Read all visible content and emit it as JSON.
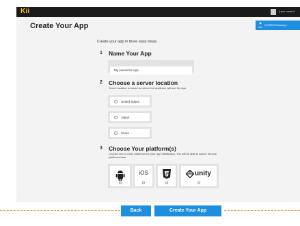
{
  "header": {
    "logo": "Kii",
    "user_name": "(user name h"
  },
  "page": {
    "title": "Create Your App",
    "download_label": "IOSSDKTutorial.pr",
    "intro": "Create your app in three easy steps."
  },
  "steps": [
    {
      "num": "1",
      "title": "Name Your App",
      "input_value": "My Awesome App"
    },
    {
      "num": "2",
      "title": "Choose a server location",
      "desc": "Server location is based on where the audience will use the app.",
      "options": [
        "United States",
        "Japan",
        "China"
      ]
    },
    {
      "num": "3",
      "title": "Choose Your platform(s)",
      "desc_line1": "Choose one or more platforms for your app distribution. You will be able to add or remove",
      "desc_line2": "platforms later.",
      "platforms": [
        "android-icon",
        "iOS",
        "html5-icon",
        "unity"
      ]
    }
  ],
  "buttons": {
    "back": "Back",
    "create": "Create Your App"
  },
  "colors": {
    "accent": "#1e8fe0",
    "logo": "#f5c400",
    "dash": "#f0932b"
  }
}
